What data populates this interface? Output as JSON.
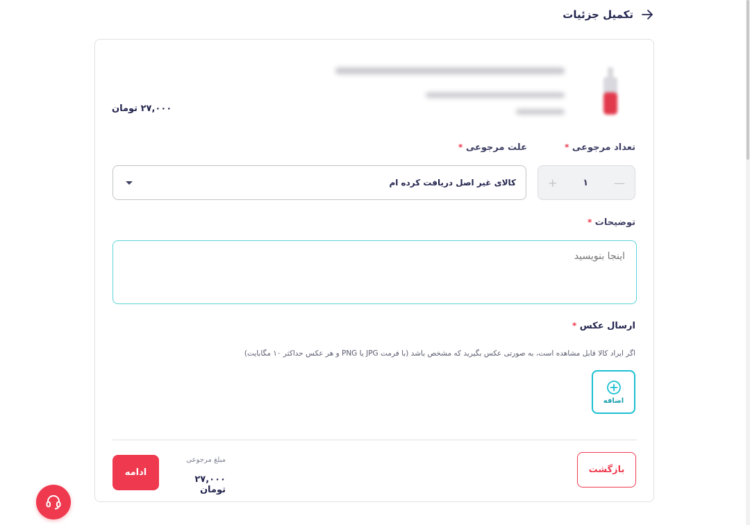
{
  "header": {
    "title": "تکمیل جزئیات"
  },
  "product": {
    "price": "۲۷,۰۰۰ تومان"
  },
  "form": {
    "quantity_label": "تعداد مرجوعی",
    "quantity_value": "۱",
    "reason_label": "علت مرجوعی",
    "reason_value": "کالای غیر اصل دریافت کرده ام",
    "description_label": "توضیحات",
    "description_placeholder": "اینجا بنویسید",
    "photo_label": "ارسال عکس",
    "photo_hint": "اگر ایراد کالا قابل مشاهده است، به صورتی عکس بگیرید که مشخص باشد (با فرمت JPG یا PNG و هر عکس حداکثر ۱۰ مگابایت)",
    "add_photo_label": "اضافه",
    "required_mark": "*"
  },
  "footer": {
    "back_label": "بازگشت",
    "refund_label": "مبلغ مرجوعی",
    "refund_amount": "۲۷,۰۰۰ تومان",
    "continue_label": "ادامه"
  },
  "colors": {
    "accent": "#ef394e",
    "teal": "#19bfd3",
    "text_dark": "#23254e"
  }
}
